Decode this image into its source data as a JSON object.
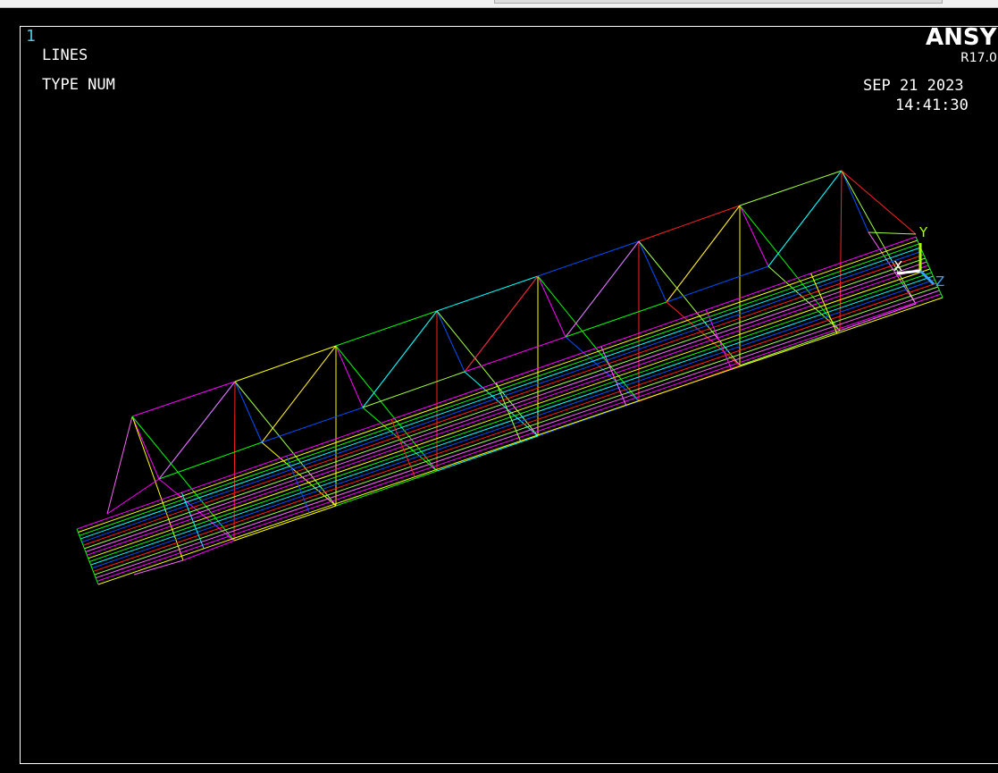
{
  "window": {
    "number": "1"
  },
  "plot": {
    "title": "LINES",
    "subtitle": "TYPE NUM",
    "brand": "ANSYS",
    "version": "R17.0",
    "date": "SEP 21 2023",
    "time": "14:41:30"
  },
  "triad": {
    "x_label": "X",
    "y_label": "Y",
    "z_label": "Z"
  },
  "colors": [
    "#ff00ff",
    "#ffff00",
    "#00ff00",
    "#00ffff",
    "#0050ff",
    "#ff2020",
    "#a0ff40",
    "#ff60ff"
  ]
}
